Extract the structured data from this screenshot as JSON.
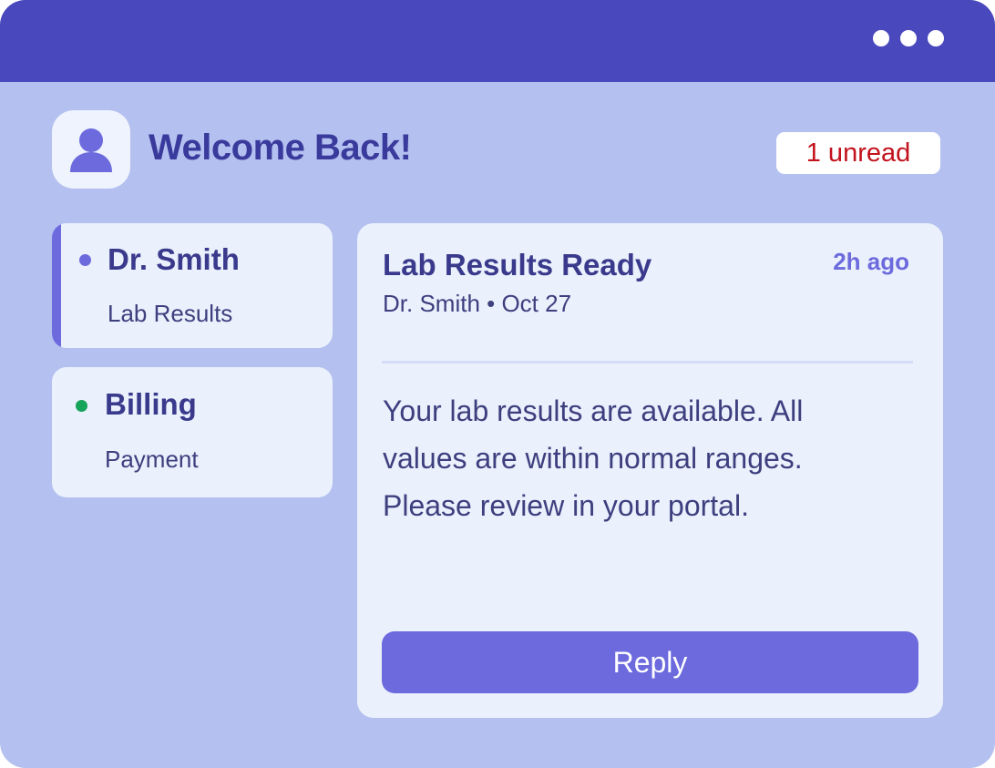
{
  "window": {
    "menu_icon": "more-dots-icon"
  },
  "header": {
    "avatar_icon": "user-icon",
    "title": "Welcome Back!",
    "unread_badge": "1 unread"
  },
  "threads": [
    {
      "name": "Dr. Smith",
      "subtitle": "Lab Results",
      "status_color": "#6c6add",
      "selected": true
    },
    {
      "name": "Billing",
      "subtitle": "Payment",
      "status_color": "#16a35a",
      "selected": false
    }
  ],
  "message": {
    "subject": "Lab Results Ready",
    "time": "2h ago",
    "meta": "Dr. Smith • Oct 27",
    "body": "Your lab results are available. All values are within normal ranges. Please review in your portal.",
    "reply_label": "Reply"
  },
  "colors": {
    "titlebar": "#4a48bd",
    "background": "#b4c0ef",
    "card": "#eaf0fc",
    "accent": "#6c6add",
    "unread": "#c2121c"
  }
}
